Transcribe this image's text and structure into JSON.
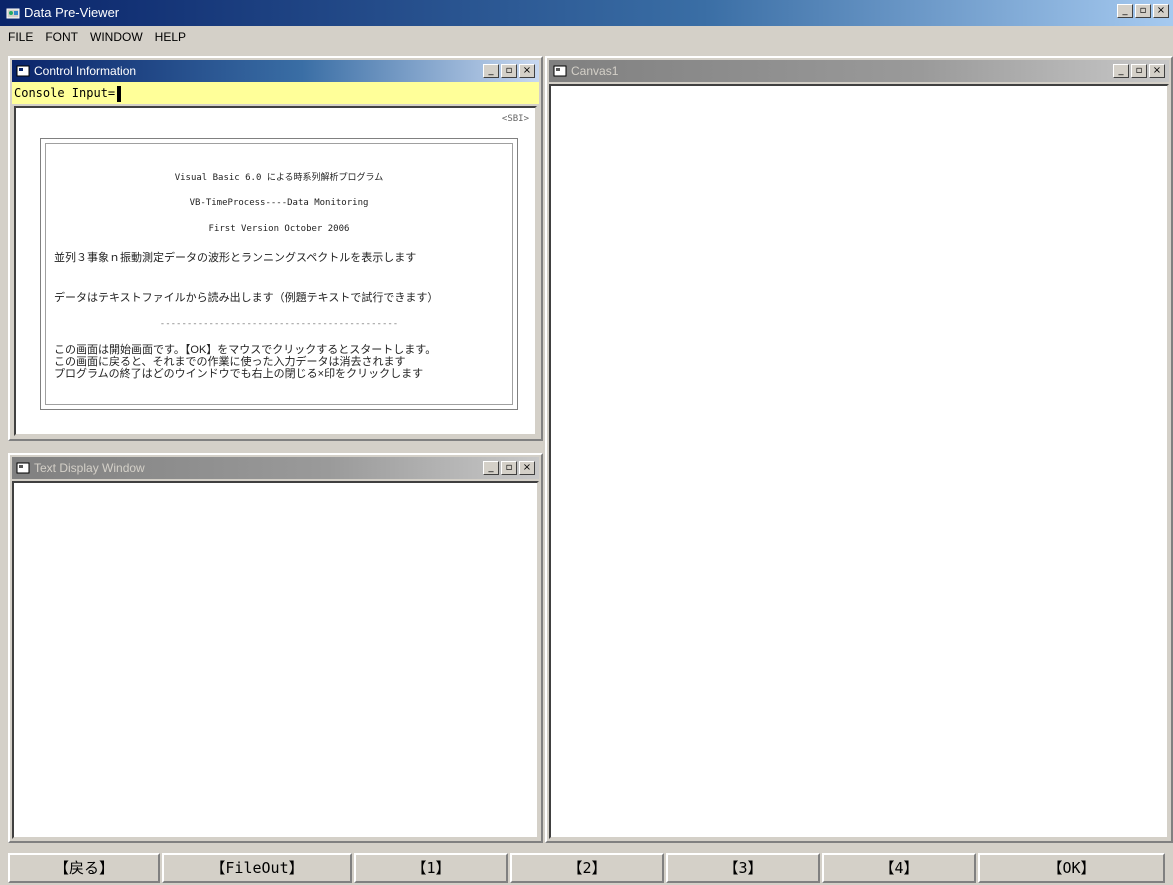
{
  "app": {
    "title": "Data Pre-Viewer",
    "window_buttons": [
      "_",
      "▫",
      "×"
    ]
  },
  "menu": {
    "items": [
      "FILE",
      "FONT",
      "WINDOW",
      "HELP"
    ]
  },
  "control_window": {
    "title": "Control Information",
    "console_label": "Console Input=",
    "sbi": "<SBI>",
    "splash": {
      "line1": "Visual Basic 6.0 による時系列解析プログラム",
      "line2": "VB-TimeProcess----Data Monitoring",
      "line3": "First Version October 2006",
      "line4": "並列３事象ｎ振動測定データの波形とランニングスペクトルを表示します",
      "line5": "データはテキストファイルから読み出します（例題テキストで試行できます）",
      "separator": "--------------------------------------------",
      "line6": "この画面は開始画面です。【OK】をマウスでクリックするとスタートします。",
      "line7": "この画面に戻ると、それまでの作業に使った入力データは消去されます",
      "line8": "プログラムの終了はどのウインドウでも右上の閉じる×印をクリックします"
    }
  },
  "text_window": {
    "title": "Text Display Window"
  },
  "canvas_window": {
    "title": "Canvas1"
  },
  "bottom_buttons": {
    "back": "【戻る】",
    "fileout": "【FileOut】",
    "b1": "【1】",
    "b2": "【2】",
    "b3": "【3】",
    "b4": "【4】",
    "ok": "【OK】"
  },
  "colors": {
    "active_title": "#0a246a",
    "console_bg": "#ffff99",
    "face": "#d4d0c8"
  }
}
